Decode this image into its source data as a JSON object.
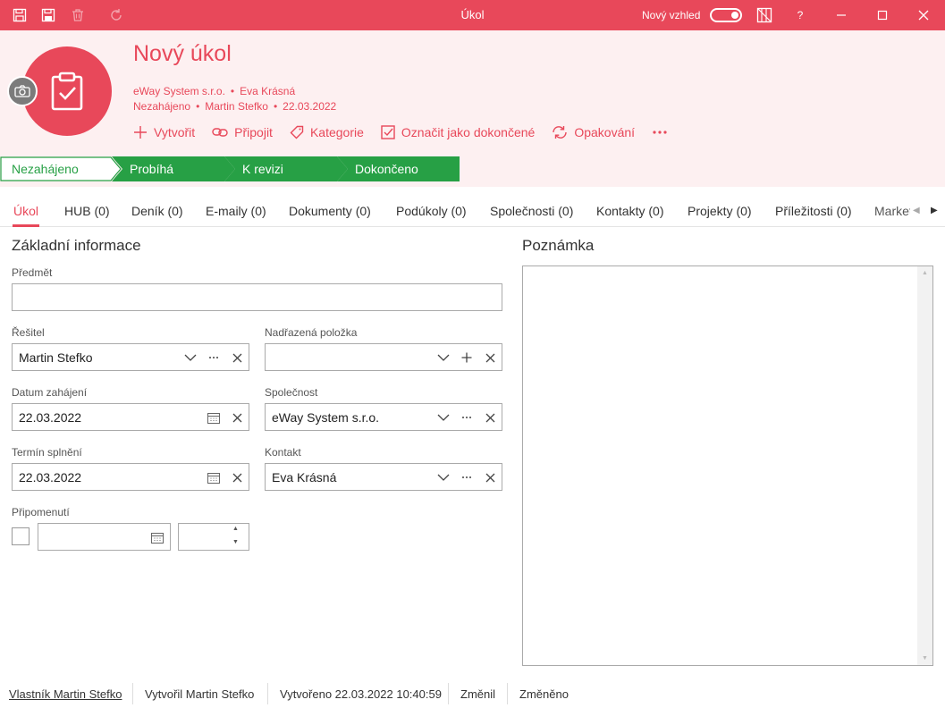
{
  "window": {
    "title": "Úkol",
    "new_look_label": "Nový vzhled",
    "help_label": "?"
  },
  "header": {
    "title": "Nový úkol",
    "meta_line1": [
      "eWay System s.r.o.",
      "Eva Krásná"
    ],
    "meta_line2": [
      "Nezahájeno",
      "Martin Stefko",
      "22.03.2022"
    ],
    "actions": {
      "create": "Vytvořit",
      "attach": "Připojit",
      "category": "Kategorie",
      "mark_done": "Označit jako dokončené",
      "recurrence": "Opakování"
    }
  },
  "stages": [
    "Nezahájeno",
    "Probíhá",
    "K revizi",
    "Dokončeno"
  ],
  "tabs": [
    "Úkol",
    "HUB (0)",
    "Deník (0)",
    "E-maily (0)",
    "Dokumenty (0)",
    "Podúkoly (0)",
    "Společnosti (0)",
    "Kontakty (0)",
    "Projekty (0)",
    "Příležitosti (0)",
    "Marketing"
  ],
  "form": {
    "section_basic": "Základní informace",
    "section_note": "Poznámka",
    "subject_label": "Předmět",
    "subject_value": "",
    "solver_label": "Řešitel",
    "solver_value": "Martin Stefko",
    "parent_label": "Nadřazená položka",
    "parent_value": "",
    "start_label": "Datum zahájení",
    "start_value": "22.03.2022",
    "company_label": "Společnost",
    "company_value": "eWay System s.r.o.",
    "due_label": "Termín splnění",
    "due_value": "22.03.2022",
    "contact_label": "Kontakt",
    "contact_value": "Eva Krásná",
    "reminder_label": "Připomenutí",
    "reminder_date": "",
    "reminder_time": ""
  },
  "footer": {
    "owner": "Vlastník Martin Stefko",
    "created_by": "Vytvořil Martin Stefko",
    "created_at": "Vytvořeno 22.03.2022 10:40:59",
    "changed_by": "Změnil",
    "changed_at": "Změněno"
  },
  "colors": {
    "accent": "#e8485a",
    "stage_green": "#27a045",
    "header_bg": "#fdf0f1"
  }
}
